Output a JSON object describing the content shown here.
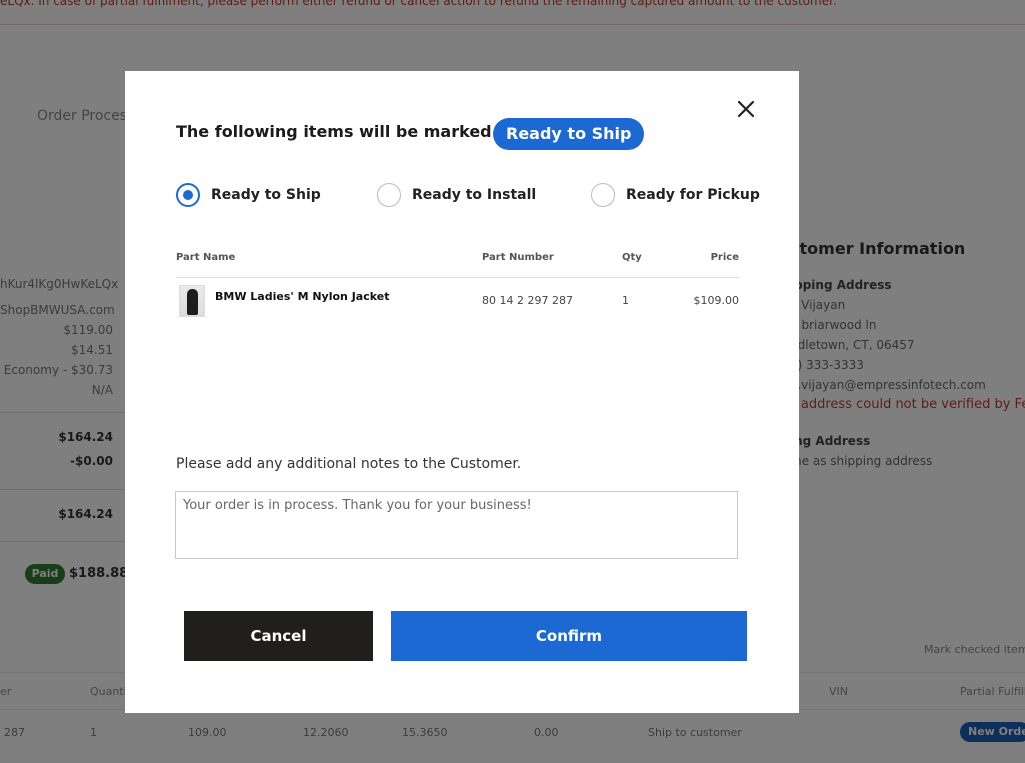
{
  "background": {
    "warning": "eLQx. In case of partial fulfilment, please perform either refund or cancel action to refund the remaining captured amount to the customer.",
    "order_process_title": "Order Process",
    "summary": {
      "order_id": "hKur4lKg0HwKeLQx",
      "site": "ShopBMWUSA.com",
      "subtotal": "$119.00",
      "tax": "$14.51",
      "shipping": "Economy - $30.73",
      "other": "N/A",
      "total": "$164.24",
      "discount": "-$0.00",
      "net_total": "$164.24",
      "paid_label": "Paid",
      "paid_total": "$188.88"
    },
    "customer": {
      "title": "stomer Information",
      "shipping_label": "ipping Address",
      "name": "a Vijayan",
      "street": "5 briarwood ln",
      "city": "ddletown, CT, 06457",
      "phone": "3) 333-3333",
      "email": "a.vijayan@empressinfotech.com",
      "error": "s address could not be verified by Fe",
      "billing_label": "ing Address",
      "billing_value": "me as shipping address"
    },
    "mark_checked": "Mark checked item",
    "table_headers": {
      "col1": "er",
      "quantity": "Quanti",
      "vin": "VIN",
      "partial": "Partial Fulfillm"
    },
    "table_row": {
      "number": "287",
      "qty": "1",
      "price": "109.00",
      "v1": "12.2060",
      "v2": "15.3650",
      "v3": "0.00",
      "ship": "Ship to customer",
      "badge": "New Order"
    }
  },
  "modal": {
    "close_icon": "close-icon",
    "heading": "The following items will be marked as",
    "status_pill": "Ready to Ship",
    "options": [
      {
        "label": "Ready to Ship",
        "checked": true
      },
      {
        "label": "Ready to Install",
        "checked": false
      },
      {
        "label": "Ready for Pickup",
        "checked": false
      }
    ],
    "table": {
      "headers": {
        "part_name": "Part Name",
        "part_number": "Part Number",
        "qty": "Qty",
        "price": "Price"
      },
      "rows": [
        {
          "part_name": "BMW Ladies' M Nylon Jacket",
          "part_number": "80 14 2 297 287",
          "qty": "1",
          "price": "$109.00"
        }
      ]
    },
    "notes_label": "Please add any additional notes to the Customer.",
    "notes_value": "Your order is in process. Thank you for your business!",
    "cancel_label": "Cancel",
    "confirm_label": "Confirm"
  },
  "colors": {
    "accent": "#1c69d4",
    "cancel_bg": "#201f1d",
    "overlay": "rgba(0,0,0,0.5)",
    "error": "#c0392b"
  }
}
